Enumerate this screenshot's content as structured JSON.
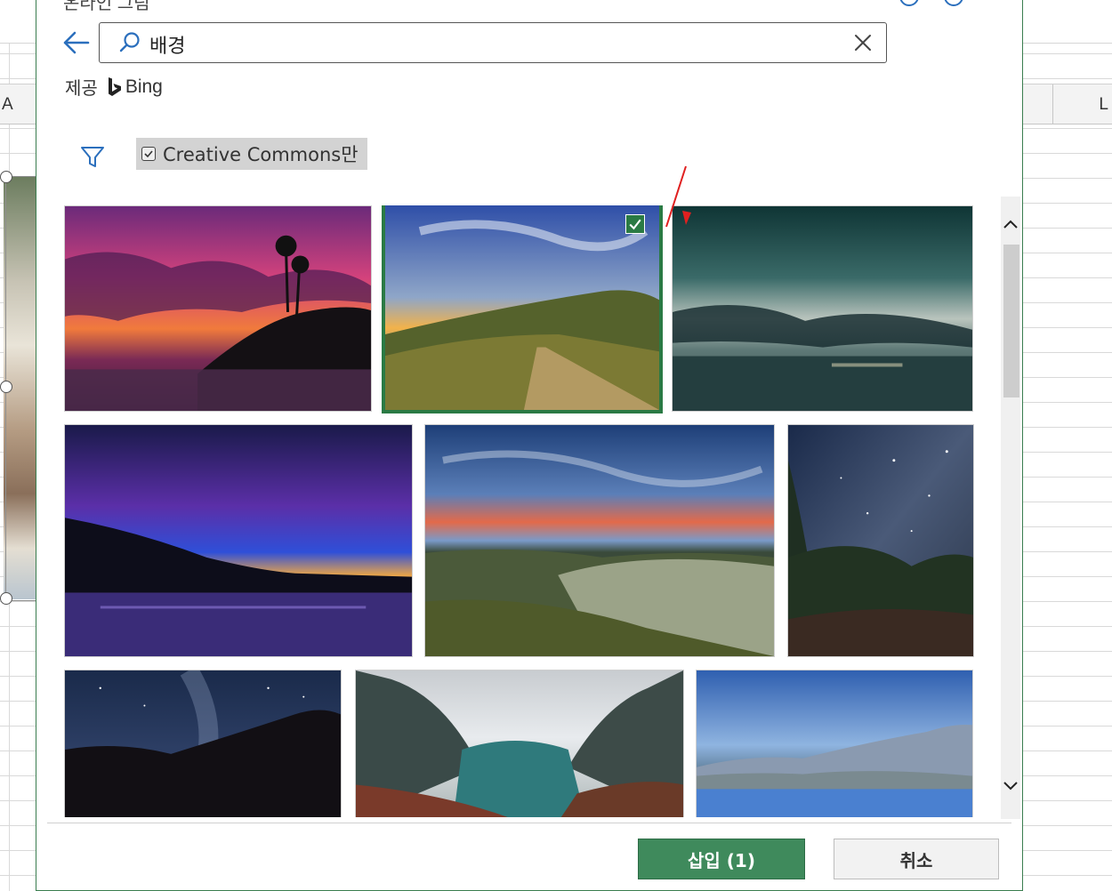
{
  "excel": {
    "col_left": "A",
    "col_right": "L"
  },
  "dialog": {
    "title": "온라인 그림"
  },
  "search": {
    "query": "배경"
  },
  "provider": {
    "label": "제공",
    "brand": "Bing"
  },
  "filter": {
    "creative_commons_label": "Creative Commons만",
    "creative_commons_checked": true
  },
  "images": [
    {
      "name": "tropical-sunset-palms",
      "selected": false
    },
    {
      "name": "hill-path-sunset",
      "selected": true
    },
    {
      "name": "stormy-sea-clouds",
      "selected": false
    },
    {
      "name": "purple-dusk-lake",
      "selected": false
    },
    {
      "name": "dunes-sunset-lagoon",
      "selected": false
    },
    {
      "name": "milky-way-forest",
      "selected": false
    },
    {
      "name": "milky-way-treeline",
      "selected": false
    },
    {
      "name": "mountain-valley",
      "selected": false
    },
    {
      "name": "mountain-lake-reflection",
      "selected": false
    }
  ],
  "footer": {
    "insert_label": "삽입 (1)",
    "cancel_label": "취소"
  },
  "colors": {
    "accent_green": "#3f8a5c",
    "selection_border": "#2a7a44",
    "icon_blue": "#2b6fbd"
  },
  "icons": {
    "back": "back-arrow-icon",
    "search": "search-icon",
    "clear": "close-icon",
    "filter": "filter-icon",
    "checkbox": "checkbox-checked-icon",
    "scroll_up": "chevron-up-icon",
    "scroll_down": "chevron-down-icon"
  }
}
